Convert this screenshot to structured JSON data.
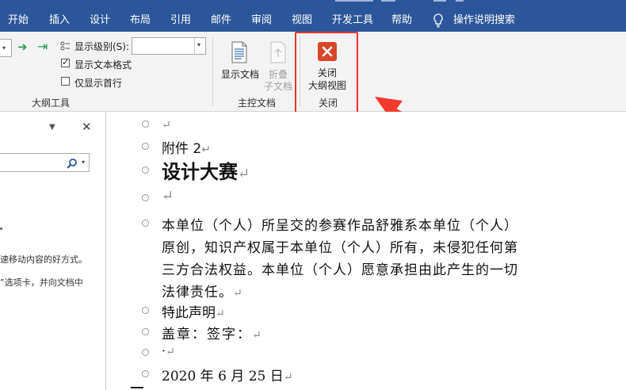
{
  "menu": {
    "items": [
      {
        "key": "file",
        "label": "开始"
      },
      {
        "key": "insert",
        "label": "插入"
      },
      {
        "key": "design",
        "label": "设计"
      },
      {
        "key": "layout",
        "label": "布局"
      },
      {
        "key": "references",
        "label": "引用"
      },
      {
        "key": "mailings",
        "label": "邮件"
      },
      {
        "key": "review",
        "label": "审阅"
      },
      {
        "key": "view",
        "label": "视图"
      },
      {
        "key": "developer",
        "label": "开发工具"
      },
      {
        "key": "help",
        "label": "帮助"
      }
    ],
    "tell_me": "操作说明搜索"
  },
  "ribbon": {
    "outline_tools": {
      "show_level_label": "显示级别(S):",
      "show_level_value": "",
      "show_text_format": "显示文本格式",
      "show_text_format_checked": true,
      "show_first_line": "仅显示首行",
      "show_first_line_checked": false,
      "group_label": "大纲工具"
    },
    "master_document": {
      "show_document": "显示文档",
      "collapse_line1": "折叠",
      "collapse_line2": "子文档",
      "group_label": "主控文档"
    },
    "close": {
      "button_line1": "关闭",
      "button_line2": "大纲视图",
      "group_label": "关闭"
    }
  },
  "side_panel": {
    "text1": "速移动内容的好方式。",
    "text2": "”选项卡，并向文档中"
  },
  "document": {
    "lines": [
      {
        "text": "",
        "mark": "↵"
      },
      {
        "text": "附件 2",
        "mark": "↵"
      },
      {
        "text": "设计大赛",
        "mark": "↵"
      },
      {
        "text": "",
        "mark": "↵"
      },
      {
        "text": "本单位（个人）所呈交的参赛作品舒雅系本单位（个人）",
        "mark": ""
      },
      {
        "text": "原创，知识产权属于本单位（个人）所有，未侵犯任何第",
        "mark": ""
      },
      {
        "text": "三方合法权益。本单位（个人）愿意承担由此产生的一切",
        "mark": ""
      },
      {
        "text": "法律责任。",
        "mark": "↵"
      },
      {
        "text": "特此声明",
        "mark": "↵"
      },
      {
        "text": "盖章：签字：",
        "mark": "↵"
      },
      {
        "text": "·",
        "mark": "↵"
      },
      {
        "text": "2020 年 6 月 25 日",
        "mark": "↵"
      }
    ]
  },
  "colors": {
    "menubar": "#2b579a",
    "ribbon": "#f3f3f3",
    "close_icon": "#d9472b",
    "highlight": "#e03a2e"
  }
}
